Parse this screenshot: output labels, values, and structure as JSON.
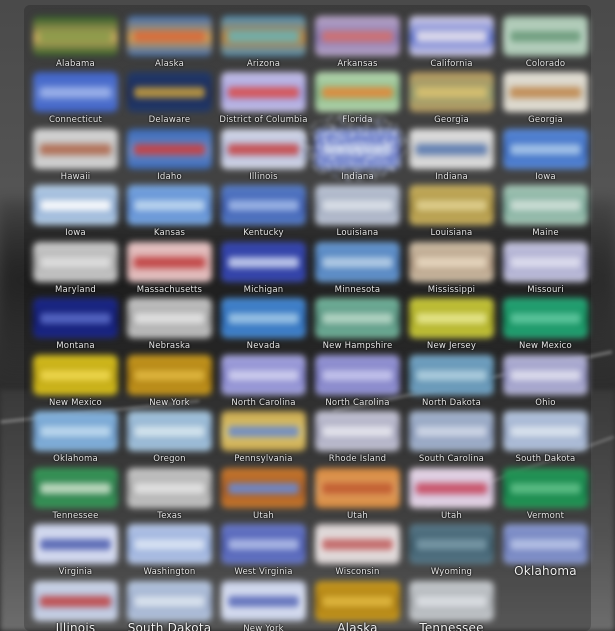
{
  "grid": {
    "rows": [
      [
        {
          "label": "Alabama",
          "colors": [
            "#2e5a2a",
            "#8a9a4a",
            "#d0b060"
          ]
        },
        {
          "label": "Alaska",
          "colors": [
            "#3f6fb2",
            "#d86a3a",
            "#d8a050"
          ]
        },
        {
          "label": "Arizona",
          "colors": [
            "#4e8fb8",
            "#6cb0b0",
            "#c48a40"
          ]
        },
        {
          "label": "Arkansas",
          "colors": [
            "#b9a7c8",
            "#d07070",
            "#8a78b0"
          ]
        },
        {
          "label": "California",
          "colors": [
            "#d8d2e8",
            "#e4e0ec",
            "#5a6fcf"
          ]
        },
        {
          "label": "Colorado",
          "colors": [
            "#a8c4b0",
            "#6a9a7a",
            "#c0d8c8"
          ]
        }
      ],
      [
        {
          "label": "Connecticut",
          "colors": [
            "#3f63c8",
            "#9fb4ea",
            "#5a7ad0"
          ]
        },
        {
          "label": "Delaware",
          "colors": [
            "#223a6a",
            "#c09a40",
            "#1a2a5a"
          ]
        },
        {
          "label": "District of Columbia",
          "colors": [
            "#c4c0e6",
            "#d85050",
            "#a4a0e0"
          ]
        },
        {
          "label": "Florida",
          "colors": [
            "#b8d8b0",
            "#e08a3a",
            "#88b888"
          ]
        },
        {
          "label": "Georgia",
          "colors": [
            "#b89a60",
            "#d8c070",
            "#98a070"
          ]
        },
        {
          "label": "Georgia",
          "colors": [
            "#e6e2d8",
            "#c08a50",
            "#d0ccc0"
          ]
        }
      ],
      [
        {
          "label": "Hawaii",
          "colors": [
            "#d8d8d8",
            "#b06a50",
            "#c0c0c0"
          ]
        },
        {
          "label": "Idaho",
          "colors": [
            "#3a6ab8",
            "#c84040",
            "#6a8ac8"
          ]
        },
        {
          "label": "Illinois",
          "colors": [
            "#d8dcea",
            "#c84848",
            "#b0b8d8"
          ]
        },
        {
          "label": "Indiana",
          "colors": [
            "#8fa0d8",
            "#c7d0ea",
            "#5a6ac0"
          ]
        },
        {
          "label": "Indiana",
          "colors": [
            "#e2e2e2",
            "#5a7ab0",
            "#c8c8c8"
          ]
        },
        {
          "label": "Iowa",
          "colors": [
            "#5a8ad8",
            "#a8c8ea",
            "#3a6ac0"
          ]
        }
      ],
      [
        {
          "label": "Iowa",
          "colors": [
            "#b8d0e8",
            "#ffffff",
            "#8aa8d0"
          ]
        },
        {
          "label": "Kansas",
          "colors": [
            "#7aa8e0",
            "#c0d8f0",
            "#5a88d0"
          ]
        },
        {
          "label": "Kentucky",
          "colors": [
            "#5a80c8",
            "#a0b8e8",
            "#3a5ab0"
          ]
        },
        {
          "label": "Louisiana",
          "colors": [
            "#c0c8d8",
            "#dde2ea",
            "#9aa4b8"
          ]
        },
        {
          "label": "Louisiana",
          "colors": [
            "#c8b060",
            "#e0d090",
            "#a89040"
          ]
        },
        {
          "label": "Maine",
          "colors": [
            "#a8c8b8",
            "#d0e0d8",
            "#78a898"
          ]
        }
      ],
      [
        {
          "label": "Maryland",
          "colors": [
            "#cfcfcf",
            "#e0e0e0",
            "#aaaaaa"
          ]
        },
        {
          "label": "Massachusetts",
          "colors": [
            "#e8c8c8",
            "#c04040",
            "#d8a8a8"
          ]
        },
        {
          "label": "Michigan",
          "colors": [
            "#3a4ab0",
            "#c8d0f0",
            "#2a3aa0"
          ]
        },
        {
          "label": "Minnesota",
          "colors": [
            "#6a9ad0",
            "#b8d0e8",
            "#4a7ab8"
          ]
        },
        {
          "label": "Mississippi",
          "colors": [
            "#d0c0a8",
            "#e8d8c0",
            "#b09880"
          ]
        },
        {
          "label": "Missouri",
          "colors": [
            "#c8c8e0",
            "#e0e0f0",
            "#a0a0c8"
          ]
        }
      ],
      [
        {
          "label": "Montana",
          "colors": [
            "#1e2a8a",
            "#5a6ac8",
            "#101a70"
          ]
        },
        {
          "label": "Nebraska",
          "colors": [
            "#c8c8c8",
            "#e4e4e4",
            "#a0a0a0"
          ]
        },
        {
          "label": "Nevada",
          "colors": [
            "#4a8ad0",
            "#a0c8e8",
            "#2a6ab8"
          ]
        },
        {
          "label": "New Hampshire",
          "colors": [
            "#78b8a0",
            "#b8d8c8",
            "#508a78"
          ]
        },
        {
          "label": "New Jersey",
          "colors": [
            "#c8c840",
            "#e8e890",
            "#a8a820"
          ]
        },
        {
          "label": "New Mexico",
          "colors": [
            "#2aa87a",
            "#60c8a0",
            "#108a5a"
          ]
        }
      ],
      [
        {
          "label": "New Mexico",
          "colors": [
            "#d8c020",
            "#f0d850",
            "#b8a010"
          ]
        },
        {
          "label": "New York",
          "colors": [
            "#c89a20",
            "#e0b840",
            "#a87a10"
          ]
        },
        {
          "label": "North Carolina",
          "colors": [
            "#a8a8e0",
            "#d0d0f0",
            "#8080c8"
          ]
        },
        {
          "label": "North Carolina",
          "colors": [
            "#9a9ad8",
            "#c8c8ee",
            "#7a7ac0"
          ]
        },
        {
          "label": "North Dakota",
          "colors": [
            "#78a8c8",
            "#b0d0e0",
            "#5888a8"
          ]
        },
        {
          "label": "Ohio",
          "colors": [
            "#b8b8d8",
            "#e0e0f0",
            "#9090c0"
          ]
        }
      ],
      [
        {
          "label": "Oklahoma",
          "colors": [
            "#8ab8e0",
            "#c0dcf0",
            "#6a98c8"
          ]
        },
        {
          "label": "Oregon",
          "colors": [
            "#a8c8e0",
            "#d8e8f0",
            "#88a8c8"
          ]
        },
        {
          "label": "Pennsylvania",
          "colors": [
            "#c8a850",
            "#6a8ac8",
            "#e0c870"
          ]
        },
        {
          "label": "Rhode Island",
          "colors": [
            "#c8c8d8",
            "#e8e8f0",
            "#a0a0b8"
          ]
        },
        {
          "label": "South Carolina",
          "colors": [
            "#a8b8d0",
            "#d0d8e8",
            "#8898b8"
          ]
        },
        {
          "label": "South Dakota",
          "colors": [
            "#b8c8e0",
            "#dde6f0",
            "#98a8c8"
          ]
        }
      ],
      [
        {
          "label": "Tennessee",
          "colors": [
            "#3a9a5a",
            "#c8e0c8",
            "#2a7a4a"
          ]
        },
        {
          "label": "Texas",
          "colors": [
            "#c8c8c8",
            "#e4e4e4",
            "#a8a8a8"
          ]
        },
        {
          "label": "Utah",
          "colors": [
            "#c87a30",
            "#6a8ad0",
            "#a85a20"
          ]
        },
        {
          "label": "Utah",
          "colors": [
            "#d88a40",
            "#c05a30",
            "#e0a060"
          ]
        },
        {
          "label": "Utah",
          "colors": [
            "#e8d8e8",
            "#c84a60",
            "#d0c0d8"
          ]
        },
        {
          "label": "Vermont",
          "colors": [
            "#2a9a5a",
            "#60c088",
            "#108048"
          ]
        }
      ],
      [
        {
          "label": "Virginia",
          "colors": [
            "#c8d0ea",
            "#5060b0",
            "#e0e4f4"
          ]
        },
        {
          "label": "Washington",
          "colors": [
            "#b8c8e8",
            "#dde6f4",
            "#90a8d8"
          ]
        },
        {
          "label": "West Virginia",
          "colors": [
            "#6a7ac8",
            "#b0bce8",
            "#4a5ab0"
          ]
        },
        {
          "label": "Wisconsin",
          "colors": [
            "#d8d0d0",
            "#c06060",
            "#ebe6e6"
          ]
        },
        {
          "label": "Wyoming",
          "colors": [
            "#5a7a8a",
            "#7a9aa8",
            "#3a5a6a"
          ]
        },
        {
          "label": "Oklahoma",
          "colors": [
            "#8a9ad0",
            "#b8c4e8",
            "#6a7ab8"
          ],
          "big": true
        }
      ],
      [
        {
          "label": "Illinois",
          "colors": [
            "#d0d8ea",
            "#c04848",
            "#b0bcd8"
          ],
          "big": true
        },
        {
          "label": "South Dakota",
          "colors": [
            "#b8c8e0",
            "#dde6f0",
            "#98a8c8"
          ],
          "big": true
        },
        {
          "label": "New York",
          "colors": [
            "#c8d0e8",
            "#5a6ab8",
            "#e0e6f4"
          ]
        },
        {
          "label": "Alaska",
          "colors": [
            "#c89a20",
            "#e0b840",
            "#a87a10"
          ],
          "big": true
        },
        {
          "label": "Tennessee",
          "colors": [
            "#c8ccd0",
            "#dde0e4",
            "#a8acb0"
          ],
          "big": true
        },
        {
          "label": "",
          "colors": [
            "#2a2a2a",
            "#2a2a2a",
            "#2a2a2a"
          ],
          "empty": true
        }
      ]
    ]
  }
}
